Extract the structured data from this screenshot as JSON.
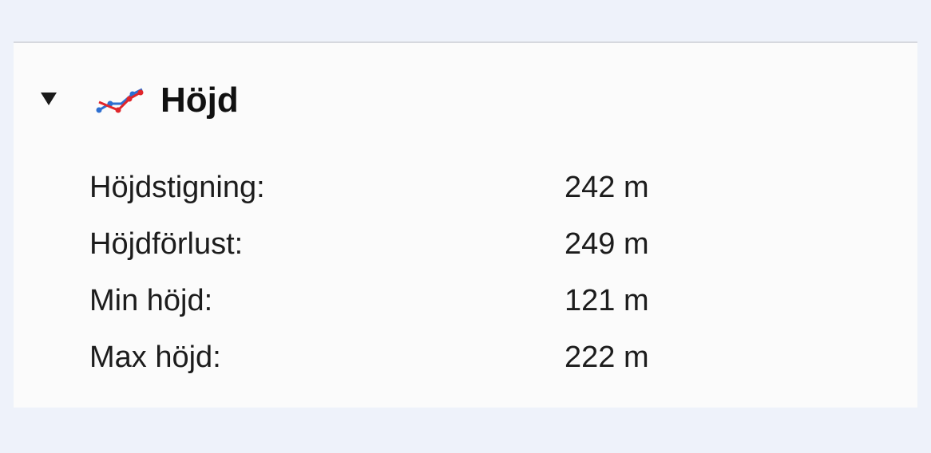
{
  "section": {
    "title": "Höjd",
    "expanded": true,
    "icon": "elevation-chart-icon",
    "colors": {
      "icon_red": "#e0262b",
      "icon_blue": "#2d6fd1"
    }
  },
  "stats": [
    {
      "label": "Höjdstigning:",
      "value": "242 m"
    },
    {
      "label": "Höjdförlust:",
      "value": "249 m"
    },
    {
      "label": "Min höjd:",
      "value": "121 m"
    },
    {
      "label": "Max höjd:",
      "value": "222 m"
    }
  ]
}
